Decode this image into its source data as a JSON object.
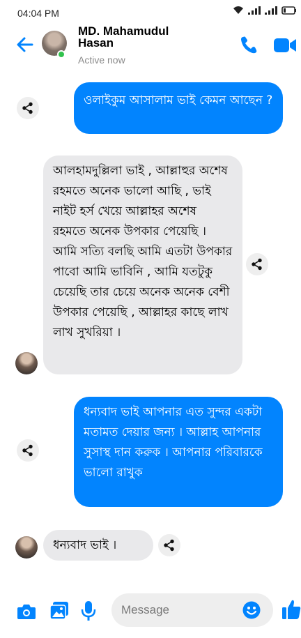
{
  "status_bar": {
    "time": "04:04 PM"
  },
  "header": {
    "contact_name": "MD. Mahamudul Hasan",
    "contact_status": "Active now"
  },
  "messages": [
    {
      "direction": "outgoing",
      "text": "ওলাইকুম আসালাম ভাই কেমন আছেন ?"
    },
    {
      "direction": "incoming",
      "text": "আলহামদুল্লিলা ভাই , আল্লাহুর অশেষ রহমতে অনেক ভালো আছি , ভাই নাইট হর্স খেয়ে আল্লাহর অশেষ রহমতে অনেক উপকার পেয়েছি । আমি সত্যি বলছি আমি এতটা উপকার পাবো আমি ভাবিনি , আমি যতটুকু চেয়েছি তার চেয়ে অনেক অনেক বেশী উপকার পেয়েছি , আল্লাহর কাছে লাখ লাখ সুখরিয়া ।"
    },
    {
      "direction": "outgoing",
      "text": "ধন্যবাদ ভাই আপনার এত সুন্দর একটা মতামত দেয়ার জন্য । আল্লাহ আপনার সুসাস্থ দান করুক । আপনার পরিবারকে ভালো রাখুক"
    },
    {
      "direction": "incoming",
      "text": "ধন্যবাদ ভাই ।"
    }
  ],
  "composer": {
    "placeholder": "Message"
  },
  "colors": {
    "accent": "#0284fe",
    "incoming_bubble": "#e9e9eb",
    "online": "#31c24d"
  },
  "icons": [
    "back-arrow-icon",
    "phone-icon",
    "video-camera-icon",
    "share-icon",
    "camera-icon",
    "image-icon",
    "microphone-icon",
    "emoji-icon",
    "thumbs-up-icon",
    "wifi-icon",
    "signal-icon",
    "battery-icon"
  ]
}
